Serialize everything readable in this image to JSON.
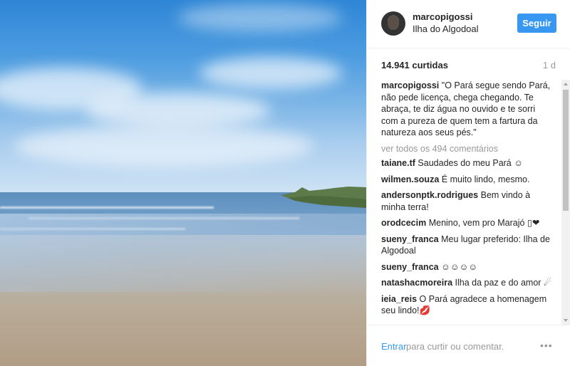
{
  "post": {
    "username": "marcopigossi",
    "location": "Ilha do Algodoal",
    "follow_label": "Seguir",
    "likes": "14.941 curtidas",
    "time": "1 d",
    "caption": "\"O Pará segue sendo Pará, não pede licença, chega chegando. Te abraça, te diz água no ouvido e te sorri com a pureza de quem tem a fartura da natureza aos seus pés.\"",
    "view_all": "ver todos os 494 comentários"
  },
  "comments": [
    {
      "user": "taiane.tf",
      "text": "Saudades do meu Pará ☺"
    },
    {
      "user": "wilmen.souza",
      "text": "É muito lindo, mesmo."
    },
    {
      "user": "andersonptk.rodrigues",
      "text": "Bem vindo à minha terra!"
    },
    {
      "user": "orodcecim",
      "text": "Menino, vem pro Marajó ▯❤"
    },
    {
      "user": "sueny_franca",
      "text": "Meu lugar preferido: Ilha de Algodoal"
    },
    {
      "user": "sueny_franca",
      "text": "☺☺☺☺"
    },
    {
      "user": "natashacmoreira",
      "text": "Ilha da paz e do amor ☄"
    },
    {
      "user": "ieia_reis",
      "text": "O Pará agradece a homenagem seu lindo!💋"
    }
  ],
  "footer": {
    "login_link": "Entrar",
    "prompt": "para curtir ou comentar.",
    "more_icon": "•••"
  }
}
